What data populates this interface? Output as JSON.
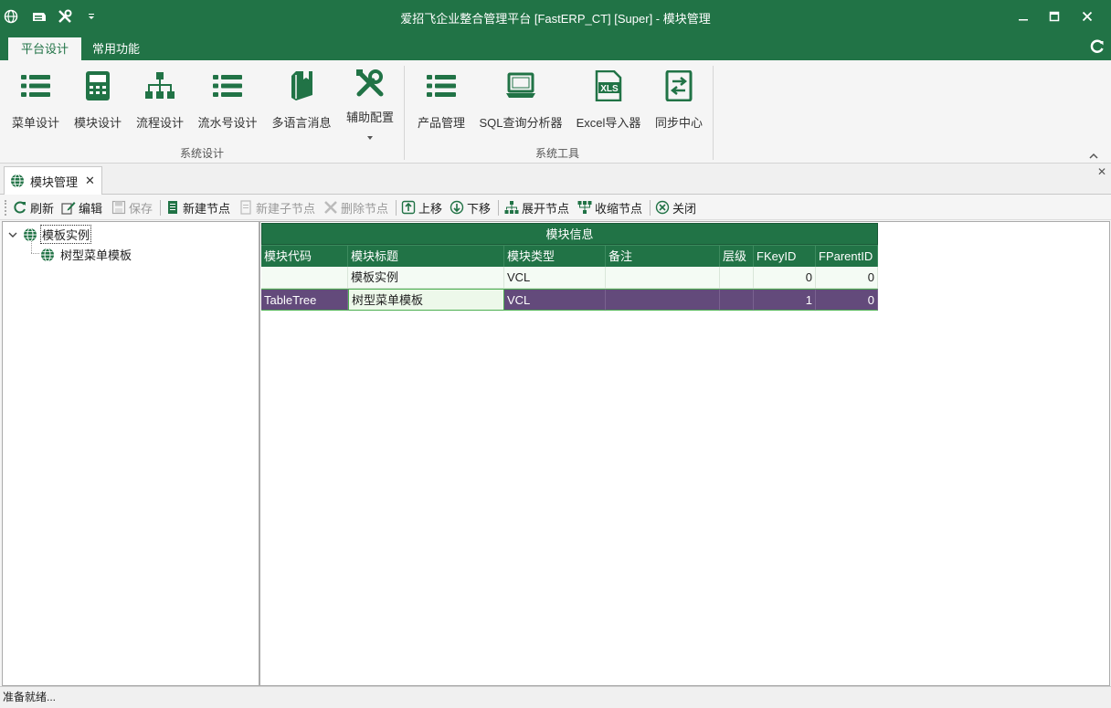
{
  "window": {
    "title": "爱招飞企业整合管理平台 [FastERP_CT] [Super] - 模块管理",
    "accent": "#217346"
  },
  "ribbon": {
    "tabs": [
      {
        "label": "平台设计",
        "active": true
      },
      {
        "label": "常用功能",
        "active": false
      }
    ],
    "groups": [
      {
        "label": "系统设计",
        "buttons": [
          {
            "label": "菜单设计",
            "icon": "list-icon"
          },
          {
            "label": "模块设计",
            "icon": "calculator-icon"
          },
          {
            "label": "流程设计",
            "icon": "sitemap-icon"
          },
          {
            "label": "流水号设计",
            "icon": "list-icon"
          },
          {
            "label": "多语言消息",
            "icon": "book-icon"
          },
          {
            "label": "辅助配置",
            "icon": "tools-icon"
          }
        ]
      },
      {
        "label": "系统工具",
        "buttons": [
          {
            "label": "产品管理",
            "icon": "list-icon"
          },
          {
            "label": "SQL查询分析器",
            "icon": "laptop-icon"
          },
          {
            "label": "Excel导入器",
            "icon": "xls-icon"
          },
          {
            "label": "同步中心",
            "icon": "sync-icon"
          }
        ]
      }
    ]
  },
  "doc_tab": {
    "label": "模块管理"
  },
  "toolbar": {
    "refresh": "刷新",
    "edit": "编辑",
    "save": "保存",
    "new_node": "新建节点",
    "new_child": "新建子节点",
    "delete_node": "删除节点",
    "move_up": "上移",
    "move_down": "下移",
    "expand": "展开节点",
    "collapse": "收缩节点",
    "close": "关闭"
  },
  "tree": {
    "root": "模板实例",
    "child": "树型菜单模板"
  },
  "grid": {
    "title": "模块信息",
    "columns": [
      "模块代码",
      "模块标题",
      "模块类型",
      "备注",
      "层级",
      "FKeyID",
      "FParentID"
    ],
    "rows": [
      [
        "",
        "模板实例",
        "VCL",
        "",
        "",
        "0",
        "0"
      ],
      [
        "TableTree",
        "树型菜单模板",
        "VCL",
        "",
        "",
        "1",
        "0"
      ]
    ],
    "selected_row": 1
  },
  "status": {
    "text": "准备就绪..."
  }
}
